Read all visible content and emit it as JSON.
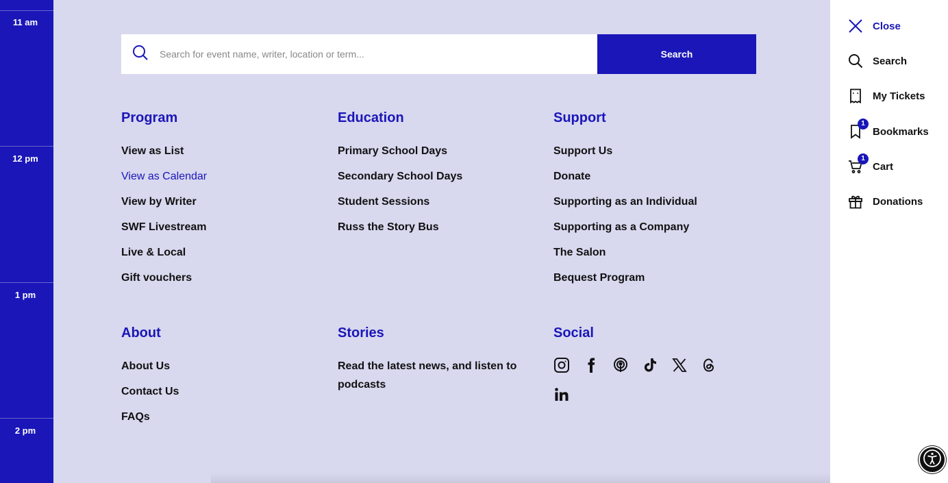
{
  "time_rail": {
    "labels": [
      "11 am",
      "12 pm",
      "1 pm",
      "2 pm"
    ]
  },
  "search": {
    "placeholder": "Search for event name, writer, location or term...",
    "button_label": "Search"
  },
  "program": {
    "title": "Program",
    "items": [
      "View as List",
      "View as Calendar",
      "View by Writer",
      "SWF Livestream",
      "Live & Local",
      "Gift vouchers"
    ],
    "active_item": "View as Calendar"
  },
  "education": {
    "title": "Education",
    "items": [
      "Primary School Days",
      "Secondary School Days",
      "Student Sessions",
      "Russ the Story Bus"
    ]
  },
  "support": {
    "title": "Support",
    "items": [
      "Support Us",
      "Donate",
      "Supporting as an Individual",
      "Supporting as a Company",
      "The Salon",
      "Bequest Program"
    ]
  },
  "about": {
    "title": "About",
    "items": [
      "About Us",
      "Contact Us",
      "FAQs"
    ]
  },
  "stories": {
    "title": "Stories",
    "text": "Read the latest news, and listen to podcasts"
  },
  "social": {
    "title": "Social",
    "icons": [
      "instagram-icon",
      "facebook-icon",
      "podcast-icon",
      "tiktok-icon",
      "x-icon",
      "threads-icon",
      "linkedin-icon"
    ]
  },
  "side_panel": {
    "close_label": "Close",
    "search_label": "Search",
    "tickets_label": "My Tickets",
    "bookmarks_label": "Bookmarks",
    "bookmarks_count": "1",
    "cart_label": "Cart",
    "cart_count": "1",
    "donations_label": "Donations"
  },
  "colors": {
    "brand_blue": "#1a16b8",
    "menu_background": "#d8d8ef",
    "panel_background": "#ffffff"
  }
}
